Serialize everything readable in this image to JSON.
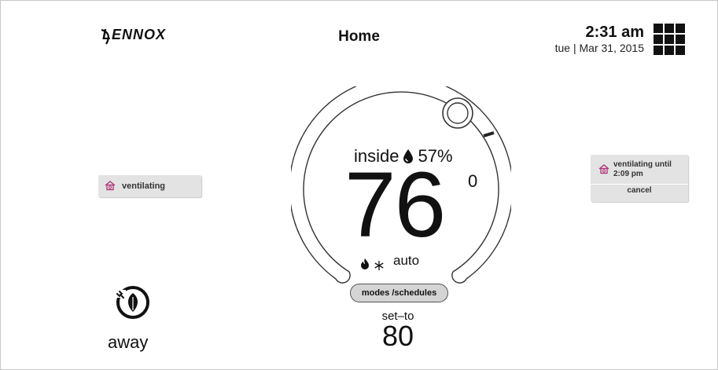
{
  "header": {
    "brand": "LENNOX",
    "title": "Home",
    "time": "2:31 am",
    "date": "tue | Mar 31, 2015"
  },
  "left_status": {
    "label": "ventilating"
  },
  "right_status": {
    "line1": "ventilating until",
    "line2": "2:09 pm",
    "cancel_label": "cancel"
  },
  "dial": {
    "inside_label": "inside",
    "humidity": "57%",
    "temperature": "76",
    "degree_mark": "0",
    "mode": "auto",
    "modes_button": "modes /schedules",
    "setto_label": "set–to",
    "setto_value": "80"
  },
  "away": {
    "label": "away"
  },
  "icons": {
    "menu": "grid-menu-icon",
    "house": "house-icon",
    "humidity": "water-drop-icon",
    "flame": "flame-icon",
    "snow": "snowflake-icon",
    "away": "leaf-plug-icon"
  },
  "colors": {
    "chip_bg": "#e3e3e3",
    "dial_stroke": "#333333",
    "modes_bg": "#d4d4d4"
  }
}
